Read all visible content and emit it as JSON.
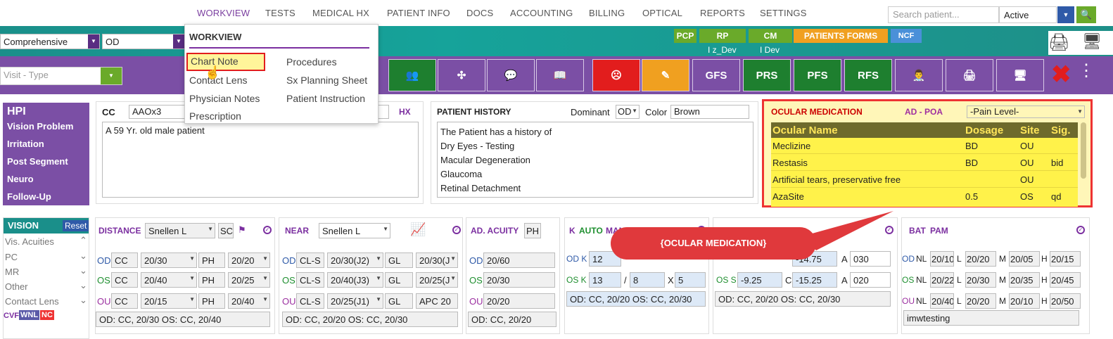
{
  "nav": {
    "items": [
      "WORKVIEW",
      "TESTS",
      "MEDICAL HX",
      "PATIENT INFO",
      "DOCS",
      "ACCOUNTING",
      "BILLING",
      "OPTICAL",
      "REPORTS",
      "SETTINGS"
    ],
    "search_placeholder": "Search patient...",
    "status": "Active"
  },
  "teal": {
    "exam_type": "Comprehensive",
    "eye": "OD",
    "tags": [
      "PCP",
      "RP",
      "CM",
      "PATIENTS FORMS",
      "NCF"
    ],
    "rp_sub": "I z_Dev",
    "cm_sub": "I Dev",
    "colors": {
      "pcp": "#6aaa2a",
      "rp": "#6aaa2a",
      "cm": "#6aaa2a",
      "forms": "#f0a020",
      "ncf": "#4a90d9"
    }
  },
  "visit_type": "Visit - Type",
  "toolbar": {
    "labels": [
      "GFS",
      "PRS",
      "PFS",
      "RFS"
    ]
  },
  "dropdown": {
    "title": "WORKVIEW",
    "col1": [
      "Chart Note",
      "Contact Lens",
      "Physician Notes",
      "Prescription"
    ],
    "col2": [
      "Procedures",
      "Sx Planning Sheet",
      "Patient Instruction"
    ]
  },
  "hpi": {
    "title": "HPI",
    "items": [
      "Vision Problem",
      "Irritation",
      "Post Segment",
      "Neuro",
      "Follow-Up"
    ]
  },
  "cc": {
    "label": "CC",
    "value": "AAOx3",
    "hx": "HX",
    "text": "A 59 Yr. old male patient"
  },
  "patient_history": {
    "title": "PATIENT HISTORY",
    "dominant_label": "Dominant",
    "dominant": "OD",
    "color_label": "Color",
    "color": "Brown",
    "lines": [
      "The Patient has a history of",
      "Dry Eyes - Testing",
      "Macular Degeneration",
      "Glaucoma",
      "Retinal Detachment"
    ]
  },
  "ocular_med": {
    "title": "OCULAR MEDICATION",
    "poa": "AD - POA",
    "pain": "-Pain Level-",
    "headers": [
      "Ocular Name",
      "Dosage",
      "Site",
      "Sig."
    ],
    "rows": [
      [
        "Meclizine",
        "BD",
        "OU",
        ""
      ],
      [
        "Restasis",
        "BD",
        "OU",
        "bid"
      ],
      [
        "Artificial tears, preservative free",
        "",
        "OU",
        ""
      ],
      [
        "AzaSite",
        "0.5",
        "OS",
        "qd"
      ]
    ]
  },
  "vision": {
    "title": "VISION",
    "reset": "Reset",
    "items": [
      "Vis. Acuities",
      "PC",
      "MR",
      "Other",
      "Contact Lens"
    ],
    "cvf": "CVF",
    "wnl": "WNL",
    "nc": "NC"
  },
  "distance": {
    "label": "DISTANCE",
    "method": "Snellen L",
    "sc": "SC",
    "rows": [
      [
        "OD",
        "CC",
        "20/30",
        "PH",
        "20/20"
      ],
      [
        "OS",
        "CC",
        "20/40",
        "PH",
        "20/25"
      ],
      [
        "OU",
        "CC",
        "20/15",
        "PH",
        "20/40"
      ]
    ],
    "summary": "OD: CC, 20/30 OS: CC, 20/40"
  },
  "near": {
    "label": "NEAR",
    "method": "Snellen L",
    "rows": [
      [
        "OD",
        "CL-S",
        "20/30(J2)",
        "GL",
        "20/30(J"
      ],
      [
        "OS",
        "CL-S",
        "20/40(J3)",
        "GL",
        "20/25(J"
      ],
      [
        "OU",
        "CL-S",
        "20/25(J1)",
        "GL",
        "APC 20"
      ]
    ],
    "summary": "OD: CC, 20/20 OS: CC, 20/30"
  },
  "adacuity": {
    "label": "AD. ACUITY",
    "ph": "PH",
    "rows": [
      [
        "OD",
        "20/60"
      ],
      [
        "OS",
        "20/30"
      ],
      [
        "OU",
        "20/20"
      ]
    ],
    "summary": "OD: CC, 20/20"
  },
  "k": {
    "k": "K",
    "auto": "AUTO",
    "manual": "MANUAL",
    "od": [
      "12",
      "",
      "",
      ""
    ],
    "os": [
      "13",
      "8",
      "5"
    ],
    "summary": "OD: CC, 20/20 OS: CC, 20/30"
  },
  "ar": {
    "od": [
      "",
      "",
      "-14.75",
      "030"
    ],
    "os": [
      "-9.25",
      "-15.25",
      "020"
    ],
    "summary": "OD: CC, 20/20 OS: CC, 20/30"
  },
  "bat": {
    "bat": "BAT",
    "pam": "PAM",
    "rows": [
      [
        "OD",
        "NL",
        "20/10",
        "L",
        "20/20",
        "M",
        "20/05",
        "H",
        "20/15"
      ],
      [
        "OS",
        "NL",
        "20/22",
        "L",
        "20/30",
        "M",
        "20/35",
        "H",
        "20/45"
      ],
      [
        "OU",
        "NL",
        "20/40",
        "L",
        "20/20",
        "M",
        "20/10",
        "H",
        "20/50"
      ]
    ],
    "note": "imwtesting"
  },
  "callout": "{OCULAR MEDICATION}"
}
